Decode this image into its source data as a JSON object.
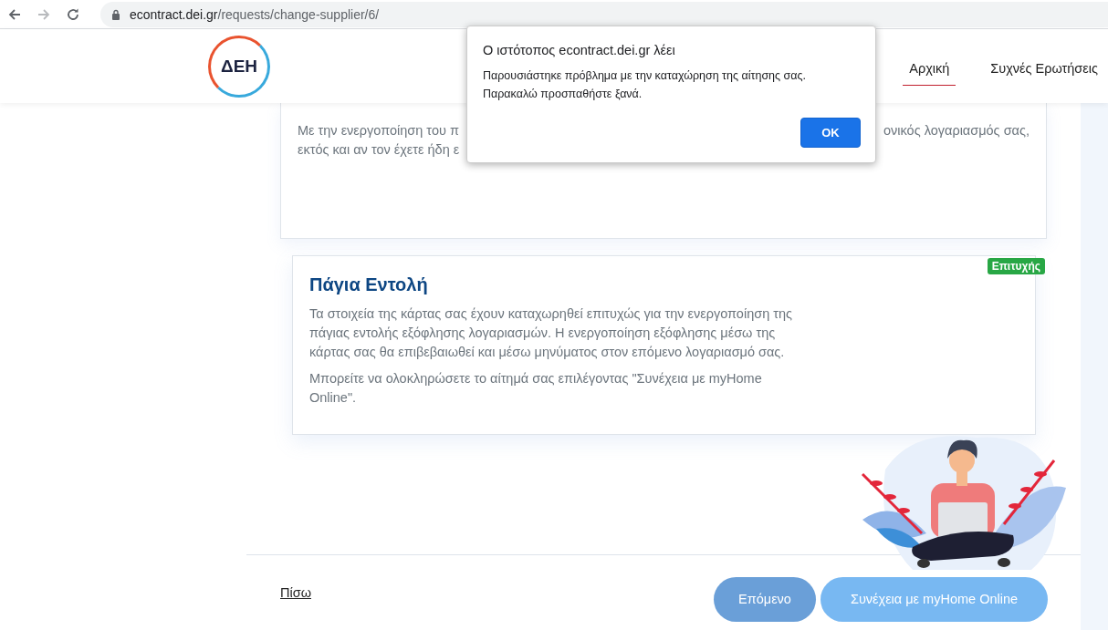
{
  "browser": {
    "address": {
      "host": "econtract.dei.gr",
      "path": "/requests/change-supplier/6/"
    }
  },
  "header": {
    "logo": "ΔΕΗ",
    "nav": [
      {
        "label": "Αρχική",
        "selected": true
      },
      {
        "label": "Συχνές Ερωτήσεις",
        "selected": false
      }
    ]
  },
  "card_partial": {
    "lines": [
      {
        "left": "Με την ενεργοποίηση του π",
        "right": "ονικός λογαριασμός σας,"
      },
      {
        "left": "εκτός και αν τον έχετε ήδη ε"
      }
    ]
  },
  "card": {
    "title": "Πάγια Εντολή",
    "badge": "Επιτυχής",
    "paragraphs": [
      "Τα στοιχεία της κάρτας σας έχουν καταχωρηθεί επιτυχώς για την ενεργοποίηση της πάγιας εντολής εξόφλησης λογαριασμών. Η ενεργοποίηση εξόφλησης μέσω της κάρτας σας θα επιβεβαιωθεί και μέσω μηνύματος στον επόμενο λογαριασμό σας.",
      "Μπορείτε να ολοκληρώσετε το αίτημά σας επιλέγοντας \"Συνέχεια με myHome Online\"."
    ]
  },
  "footer": {
    "back": "Πίσω",
    "buttons": [
      "Επόμενο",
      "Συνέχεια με myHome Online"
    ]
  },
  "dialog": {
    "title": "Ο ιστότοπος econtract.dei.gr λέει",
    "message": [
      "Παρουσιάστηκε πρόβλημα με την καταχώρηση της αίτησης σας.",
      "Παρακαλώ προσπαθήστε ξανά."
    ],
    "button": "OK"
  }
}
